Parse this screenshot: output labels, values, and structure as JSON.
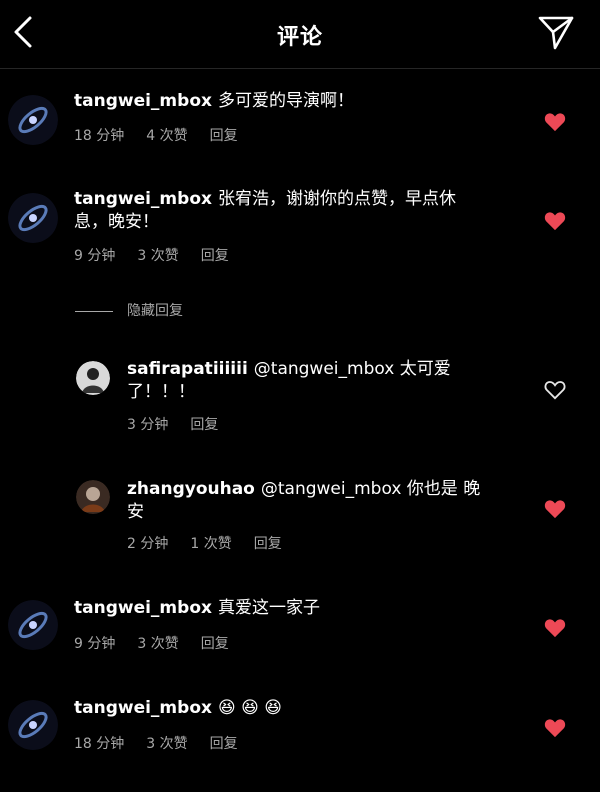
{
  "header": {
    "title": "评论",
    "back_icon": "chevron-left-icon",
    "send_icon": "paper-plane-icon"
  },
  "hidden_replies_label": "隐藏回复",
  "comments": [
    {
      "user": "tangwei_mbox",
      "text": "多可爱的导演啊！",
      "line2": "",
      "time": "18 分钟",
      "likes": "4 次赞",
      "reply": "回复",
      "liked": true
    },
    {
      "user": "tangwei_mbox",
      "text": "张宥浩，谢谢你的点赞，早点休",
      "line2": "息，晚安！",
      "time": "9 分钟",
      "likes": "3 次赞",
      "reply": "回复",
      "liked": true
    },
    {
      "user": "safirapatiiiiii",
      "text": "@tangwei_mbox 太可爱",
      "line2": "了！！！",
      "time": "3 分钟",
      "likes": "",
      "reply": "回复",
      "liked": false
    },
    {
      "user": "zhangyouhao",
      "text": "@tangwei_mbox 你也是 晚",
      "line2": "安",
      "time": "2 分钟",
      "likes": "1 次赞",
      "reply": "回复",
      "liked": true
    },
    {
      "user": "tangwei_mbox",
      "text": "真爱这一家子",
      "line2": "",
      "time": "9 分钟",
      "likes": "3 次赞",
      "reply": "回复",
      "liked": true
    },
    {
      "user": "tangwei_mbox",
      "text": "😆 😆 😆",
      "line2": "",
      "time": "18 分钟",
      "likes": "3 次赞",
      "reply": "回复",
      "liked": true
    }
  ],
  "colors": {
    "heart_liked": "#ed4956",
    "meta": "#a8a8a8",
    "background": "#000000"
  }
}
